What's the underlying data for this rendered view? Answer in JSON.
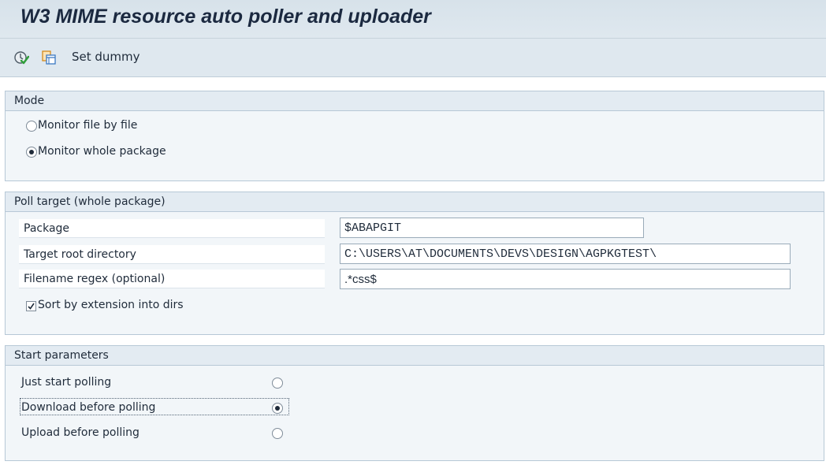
{
  "title": "W3 MIME resource auto poller and uploader",
  "toolbar": {
    "execute_icon": "execute-clock-check-icon",
    "copy_icon": "copy-windows-icon",
    "set_dummy_label": "Set dummy"
  },
  "mode": {
    "header": "Mode",
    "options": [
      {
        "label": "Monitor file by file",
        "selected": false
      },
      {
        "label": "Monitor whole package",
        "selected": true
      }
    ]
  },
  "poll_target": {
    "header": "Poll target (whole package)",
    "package_label": "Package",
    "package_value": "$ABAPGIT",
    "root_dir_label": "Target root directory",
    "root_dir_value": "C:\\USERS\\AT\\DOCUMENTS\\DEVS\\DESIGN\\AGPKGTEST\\",
    "regex_label": "Filename regex (optional)",
    "regex_value": ".*css$",
    "sort_label": "Sort by extension into dirs",
    "sort_checked": true
  },
  "start_params": {
    "header": "Start parameters",
    "options": [
      {
        "label": "Just start polling",
        "selected": false
      },
      {
        "label": "Download before polling",
        "selected": true
      },
      {
        "label": "Upload before polling",
        "selected": false
      }
    ]
  },
  "colors": {
    "titlebar_bg": "#d7e2ea",
    "group_bg": "#f2f6f9",
    "group_header_bg": "#e3ebf2",
    "text": "#1f2b3a"
  }
}
